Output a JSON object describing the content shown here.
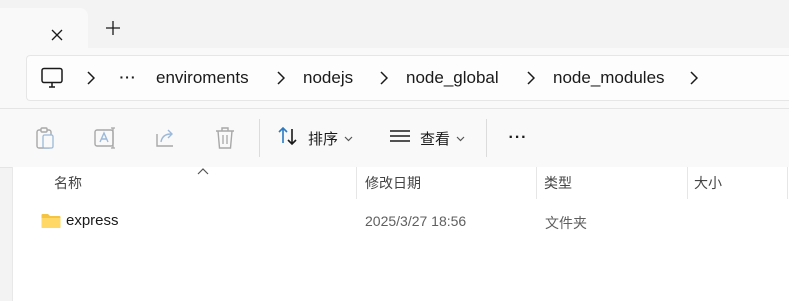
{
  "window": {
    "close_tab_icon": "close-icon",
    "new_tab_icon": "plus-icon"
  },
  "address_bar": {
    "root_icon": "this-pc-icon",
    "overflow_label": "···",
    "crumbs": [
      "enviroments",
      "nodejs",
      "node_global",
      "node_modules"
    ]
  },
  "toolbar": {
    "actions": [
      "copy-icon",
      "rename-icon",
      "share-icon",
      "delete-icon"
    ],
    "sort_label": "排序",
    "view_label": "查看",
    "more_label": "···"
  },
  "columns": {
    "name": "名称",
    "modified": "修改日期",
    "type": "类型",
    "size": "大小"
  },
  "files": [
    {
      "name": "express",
      "modified": "2025/3/27 18:56",
      "type": "文件夹",
      "size": "",
      "icon": "folder-icon"
    }
  ],
  "colors": {
    "folder": "#f6c443",
    "accent_icon": "#2b79c2",
    "disabled_icon": "#a8a8a8"
  }
}
